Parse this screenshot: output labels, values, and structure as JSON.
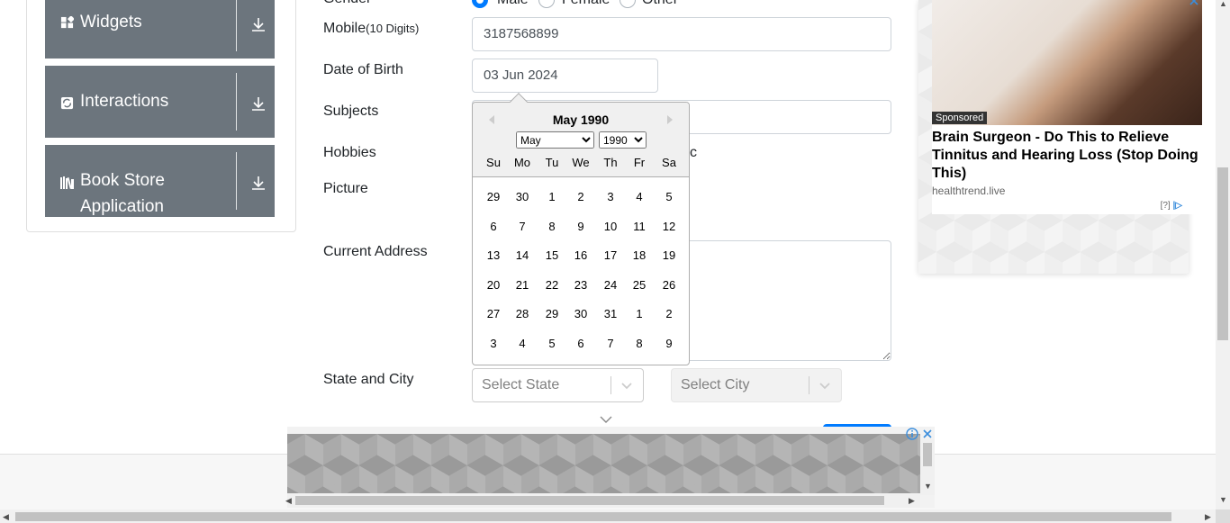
{
  "sidebar": {
    "groups": [
      {
        "label": "Widgets",
        "icon": "widgets-icon"
      },
      {
        "label": "Interactions",
        "icon": "interactions-icon"
      },
      {
        "label": "Book Store\nApplication",
        "icon": "book-store-icon"
      }
    ]
  },
  "form": {
    "gender_label": "Gender",
    "gender_options": [
      "Male",
      "Female",
      "Other"
    ],
    "mobile_label": "Mobile",
    "mobile_hint": "(10 Digits)",
    "mobile_value": "3187568899",
    "dob_label": "Date of Birth",
    "dob_value": "03 Jun 2024",
    "subjects_label": "Subjects",
    "hobbies_label": "Hobbies",
    "hobbies_partial": "c",
    "picture_label": "Picture",
    "address_label": "Current Address",
    "state_city_label": "State and City",
    "state_placeholder": "Select State",
    "city_placeholder": "Select City"
  },
  "datepicker": {
    "title": "May 1990",
    "month_selected": "May",
    "year_selected": "1990",
    "weekdays": [
      "Su",
      "Mo",
      "Tu",
      "We",
      "Th",
      "Fr",
      "Sa"
    ],
    "weeks": [
      [
        "29",
        "30",
        "1",
        "2",
        "3",
        "4",
        "5"
      ],
      [
        "6",
        "7",
        "8",
        "9",
        "10",
        "11",
        "12"
      ],
      [
        "13",
        "14",
        "15",
        "16",
        "17",
        "18",
        "19"
      ],
      [
        "20",
        "21",
        "22",
        "23",
        "24",
        "25",
        "26"
      ],
      [
        "27",
        "28",
        "29",
        "30",
        "31",
        "1",
        "2"
      ],
      [
        "3",
        "4",
        "5",
        "6",
        "7",
        "8",
        "9"
      ]
    ]
  },
  "ad_right": {
    "sponsored": "Sponsored",
    "headline": "Brain Surgeon - Do This to Relieve Tinnitus and Hearing Loss (Stop Doing This)",
    "domain": "healthtrend.live",
    "info": "[?]"
  },
  "colors": {
    "sidebar_group_bg": "#6c757d",
    "primary": "#007bff"
  }
}
